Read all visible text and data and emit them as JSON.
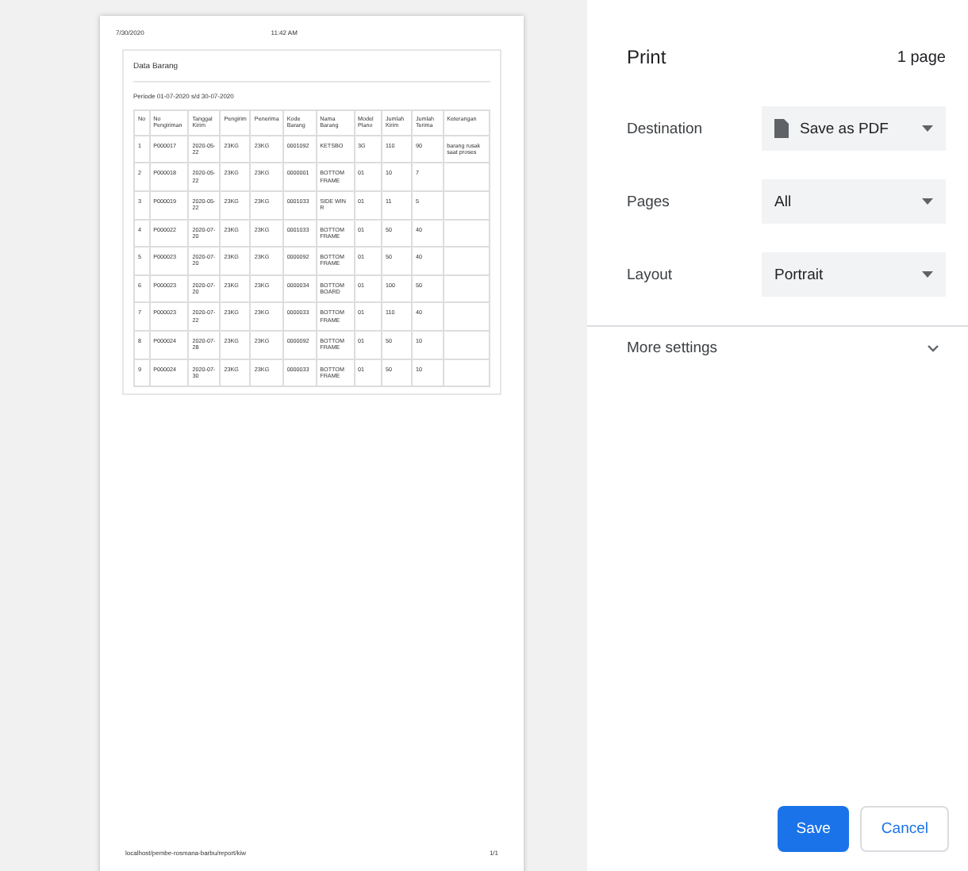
{
  "preview": {
    "header_left": "7/30/2020",
    "header_center": "11:42 AM",
    "title": "Data Barang",
    "period": "Periode 01-07-2020 s/d 30-07-2020",
    "table": {
      "columns": [
        "No",
        "No Pengiriman",
        "Tanggal Kirim",
        "Pengirim",
        "Penerima",
        "Kode Barang",
        "Nama Barang",
        "Model Plano",
        "Jumlah Kirim",
        "Jumlah Terima",
        "Keterangan"
      ],
      "rows": [
        [
          "1",
          "P000017",
          "2020-05-22",
          "23KG",
          "23KG",
          "0001092",
          "KETSBO",
          "3G",
          "110",
          "90",
          "barang rusak saat proses"
        ],
        [
          "2",
          "P000018",
          "2020-05-22",
          "23KG",
          "23KG",
          "0000001",
          "BOTTOM FRAME",
          "01",
          "10",
          "7",
          ""
        ],
        [
          "3",
          "P000019",
          "2020-05-22",
          "23KG",
          "23KG",
          "0001033",
          "SIDE WIN R",
          "01",
          "11",
          "5",
          ""
        ],
        [
          "4",
          "P000022",
          "2020-07-20",
          "23KG",
          "23KG",
          "0001033",
          "BOTTOM FRAME",
          "01",
          "50",
          "40",
          ""
        ],
        [
          "5",
          "P000023",
          "2020-07-20",
          "23KG",
          "23KG",
          "0000092",
          "BOTTOM FRAME",
          "01",
          "50",
          "40",
          ""
        ],
        [
          "6",
          "P000023",
          "2020-07-20",
          "23KG",
          "23KG",
          "0000034",
          "BOTTOM BOARD",
          "01",
          "100",
          "50",
          ""
        ],
        [
          "7",
          "P000023",
          "2020-07-22",
          "23KG",
          "23KG",
          "0000033",
          "BOTTOM FRAME",
          "01",
          "110",
          "40",
          ""
        ],
        [
          "8",
          "P000024",
          "2020-07-28",
          "23KG",
          "23KG",
          "0000092",
          "BOTTOM FRAME",
          "01",
          "50",
          "10",
          ""
        ],
        [
          "9",
          "P000024",
          "2020-07-30",
          "23KG",
          "23KG",
          "0000033",
          "BOTTOM FRAME",
          "01",
          "50",
          "10",
          ""
        ]
      ]
    },
    "footer_left": "localhost/pembe-rosmana-barbu/report/kiw",
    "footer_right": "1/1"
  },
  "panel": {
    "title": "Print",
    "page_count": "1 page",
    "settings": [
      {
        "label": "Destination",
        "value": "Save as PDF",
        "kind": "destination"
      },
      {
        "label": "Pages",
        "value": "All",
        "kind": "select"
      },
      {
        "label": "Layout",
        "value": "Portrait",
        "kind": "select"
      }
    ],
    "more_settings": {
      "label": "More settings",
      "expanded": false
    },
    "buttons": [
      {
        "label": "Save",
        "kind": "primary"
      },
      {
        "label": "Cancel",
        "kind": "secondary"
      }
    ]
  }
}
